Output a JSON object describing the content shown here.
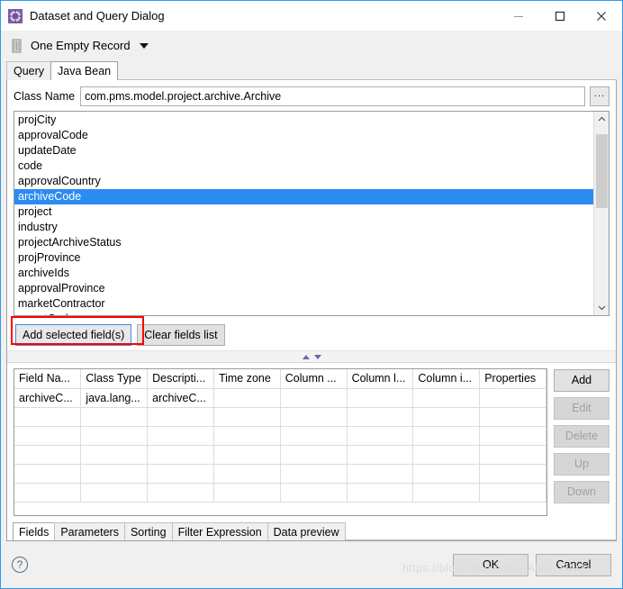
{
  "window": {
    "title": "Dataset and Query Dialog",
    "icon": "dataset-gear-icon",
    "controls": {
      "minimize": "minimize-icon",
      "maximize": "maximize-icon",
      "close": "close-icon"
    }
  },
  "toolbar": {
    "icon": "dataset-record-icon",
    "dataset_label": "One Empty Record",
    "caret": "chevron-down-icon"
  },
  "top_tabs": [
    {
      "label": "Query",
      "active": false
    },
    {
      "label": "Java Bean",
      "active": true
    }
  ],
  "class_name": {
    "label": "Class Name",
    "value": "com.pms.model.project.archive.Archive",
    "placeholder": "",
    "browse_label": "..."
  },
  "field_list": {
    "items": [
      "projCity",
      "approvalCode",
      "updateDate",
      "code",
      "approvalCountry",
      "archiveCode",
      "project",
      "industry",
      "projectArchiveStatus",
      "projProvince",
      "archiveIds",
      "approvalProvince",
      "marketContractor",
      "reportCode"
    ],
    "selected": "archiveCode",
    "selection_color": "#2a8cf0",
    "scroll_up_icon": "chevron-up-icon",
    "scroll_down_icon": "chevron-down-icon"
  },
  "field_buttons": {
    "add_selected_label": "Add selected field(s)",
    "clear_fields_label": "Clear fields list",
    "highlight_color": "#ff0000"
  },
  "sash": {
    "up_icon": "sash-up-icon",
    "down_icon": "sash-down-icon"
  },
  "table": {
    "columns": [
      "Field Na...",
      "Class Type",
      "Descripti...",
      "Time zone",
      "Column ...",
      "Column l...",
      "Column i...",
      "Properties"
    ],
    "rows": [
      [
        "archiveC...",
        "java.lang...",
        "archiveC...",
        "",
        "",
        "",
        "",
        ""
      ],
      [
        "",
        "",
        "",
        "",
        "",
        "",
        "",
        ""
      ],
      [
        "",
        "",
        "",
        "",
        "",
        "",
        "",
        ""
      ],
      [
        "",
        "",
        "",
        "",
        "",
        "",
        "",
        ""
      ],
      [
        "",
        "",
        "",
        "",
        "",
        "",
        "",
        ""
      ],
      [
        "",
        "",
        "",
        "",
        "",
        "",
        "",
        ""
      ]
    ],
    "buttons": [
      {
        "label": "Add",
        "enabled": true
      },
      {
        "label": "Edit",
        "enabled": false
      },
      {
        "label": "Delete",
        "enabled": false
      },
      {
        "label": "Up",
        "enabled": false
      },
      {
        "label": "Down",
        "enabled": false
      }
    ]
  },
  "bottom_tabs": [
    {
      "label": "Fields",
      "active": true
    },
    {
      "label": "Parameters",
      "active": false
    },
    {
      "label": "Sorting",
      "active": false
    },
    {
      "label": "Filter Expression",
      "active": false
    },
    {
      "label": "Data preview",
      "active": false
    }
  ],
  "footer": {
    "help_icon": "help-icon",
    "help_glyph": "?",
    "ok_label": "OK",
    "cancel_label": "Cancel"
  },
  "watermark": "https://blog.csdn.net/QIANG_HAO"
}
